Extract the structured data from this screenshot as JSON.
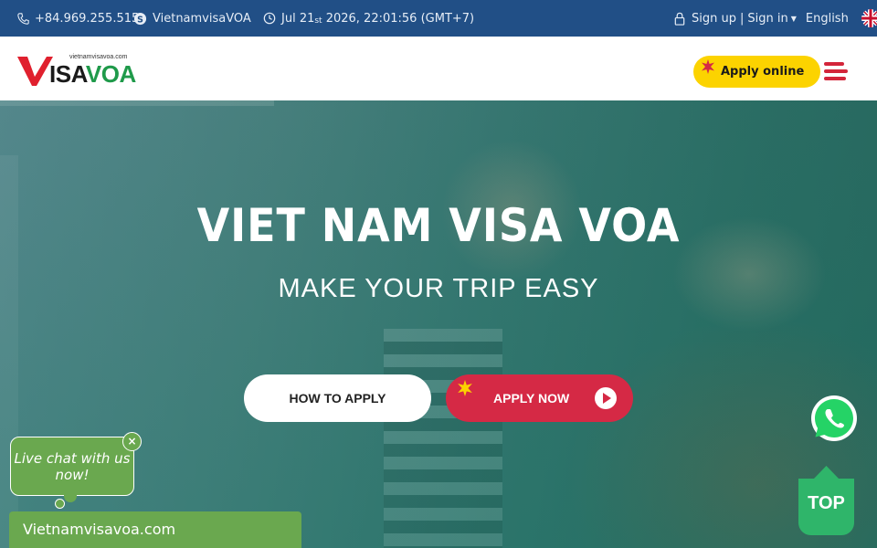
{
  "topbar": {
    "phone": "+84.969.255.515",
    "skype": "VietnamvisaVOA",
    "datetime_prefix": "Jul 21",
    "datetime_suffix": "st",
    "datetime_rest": " 2026, 22:01:56 (GMT+7)",
    "signup": "Sign up",
    "separator": "|",
    "signin": "Sign in",
    "language": "English"
  },
  "header": {
    "logo_url_text": "vietnamvisavoa.com",
    "logo_visa": "ISA",
    "logo_voa": "VOA",
    "apply_online": "Apply online"
  },
  "hero": {
    "title": "VIET NAM VISA VOA",
    "subtitle": "MAKE YOUR TRIP EASY",
    "how_to_apply": "HOW TO APPLY",
    "apply_now": "APPLY NOW"
  },
  "floating": {
    "top_label": "TOP"
  },
  "chat": {
    "bubble_text": "Live chat with us now!",
    "close": "×",
    "bar_title": "Vietnamvisavoa.com"
  },
  "colors": {
    "topbar": "#214f86",
    "accent_red": "#d52945",
    "accent_yellow": "#fcd300",
    "brand_green": "#1f9a4a",
    "chat_green": "#6aa84f",
    "whatsapp_green": "#25d366"
  }
}
